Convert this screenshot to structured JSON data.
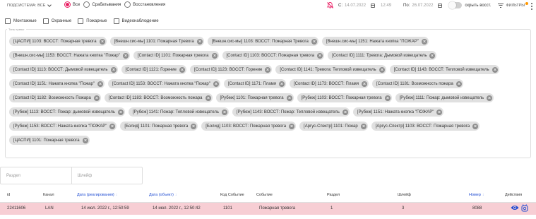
{
  "header": {
    "system_label": "ПОДСИСТЕМА: ВСЕ",
    "radios": [
      {
        "label": "Все",
        "selected": true
      },
      {
        "label": "Срабатывания",
        "selected": false
      },
      {
        "label": "Восстановления",
        "selected": false
      }
    ],
    "from_label": "С:",
    "from_date": "14.07.2022",
    "from_time": "12:49",
    "to_label": "По:",
    "to_date": "26.07.2022",
    "hide_restore_label": "скрыть восст.",
    "filters_label": "ФИЛЬТРЫ",
    "accent_color": "#e91e63"
  },
  "checkboxes": [
    "Монтажные",
    "Охранные",
    "Пожарные",
    "Видеонаблюдение"
  ],
  "types_legend": "Типы тревог",
  "chips": [
    "[ЦАСПИ] 1103: ВОССТ: Пожарная тревога",
    "[Внешн.сис-мы] 1101: Пожарная Тревога",
    "[Внешн.сис-мы] 1103: ВОССТ: Пожарная Тревога",
    "[Внешн.сис-мы] 1151: Нажата кнопка \"ПОЖАР\"",
    "[Внешн.сис-мы] 1153: ВОССТ: Нажата кнопка \"Пожар\"",
    "[Contact ID] 1101: Пожарная тревога",
    "[Contact ID] 1103: ВОССТ: Пожарная тревога",
    "[Contact ID] 1111: Тревога: Дымовой извещатель",
    "[Contact ID] 1113: ВОССТ: Дымовой извещатель",
    "[Contact ID] 1121: Горение",
    "[Contact ID] 1123: ВОССТ: Горение",
    "[Contact ID] 1141: Тревога: Тепловой извещатель",
    "[Contact ID] 1143: ВОССТ: Тепловой извещатель",
    "[Contact ID] 1151: Нажата кнопка \"Пожар\"",
    "[Contact ID] 1153: ВОССТ: Нажата кнопка \"Пожар\"",
    "[Contact ID] 1171: Пламя",
    "[Contact ID] 1173: ВОССТ: Пламя",
    "[Contact ID] 1181: Возможность пожара",
    "[Contact ID] 1182: Возможность Пожара",
    "[Contact ID] 1183: ВОССТ: Возможность пожара",
    "[Рубеж] 1101: Пожарная тревога",
    "[Рубеж] 1103: ВОССТ: Пожарная тревога",
    "[Рубеж] 1111: Пожар: дымовой извещатель",
    "[Рубеж] 1113: ВОССТ: Пожар: дымовой извещатель",
    "[Рубеж] 1141: Пожар: Тепловой извещатель",
    "[Рубеж] 1143: ВОССТ: Пожар: Тепловой извещатель",
    "[Рубеж] 1151: Нажата кнопка \"ПОЖАР\"",
    "[Рубеж] 1153: ВОССТ: Нажата кнопка \"ПОЖАР\"",
    "[Болид] 1101: Пожарная тревога",
    "[Болид] 1103: ВОССТ: Пожарная тревога",
    "[Аргус-Спектр] 1101: Пожар",
    "[Аргус-Спектр] 1103: ВОССТ: Пожарная тревога",
    "[ЦАСПИ] 1101: Пожарная тревога"
  ],
  "inputs": {
    "section_placeholder": "Раздел",
    "loop_placeholder": "Шлейф"
  },
  "table": {
    "columns": {
      "id": "id",
      "channel": "Канал",
      "date_react": "Дата (реагирования)",
      "date_object": "Дата (объект)",
      "event_code": "Код Событие",
      "event": "Событие",
      "section": "Раздел",
      "loop": "Шлейф",
      "number": "Номер",
      "actions": "Действия"
    },
    "sort_arrow": "↕",
    "rows": [
      {
        "id": "22411606",
        "channel": "LAN",
        "date_react": "14 июл. 2022 г., 12:50:59",
        "date_object": "14 июл. 2022 г., 12:50:42",
        "event_code": "1101",
        "event": "Пожарная тревога",
        "section": "1",
        "loop": "3",
        "number": "8088",
        "row_color": "#f7ced4"
      }
    ]
  }
}
